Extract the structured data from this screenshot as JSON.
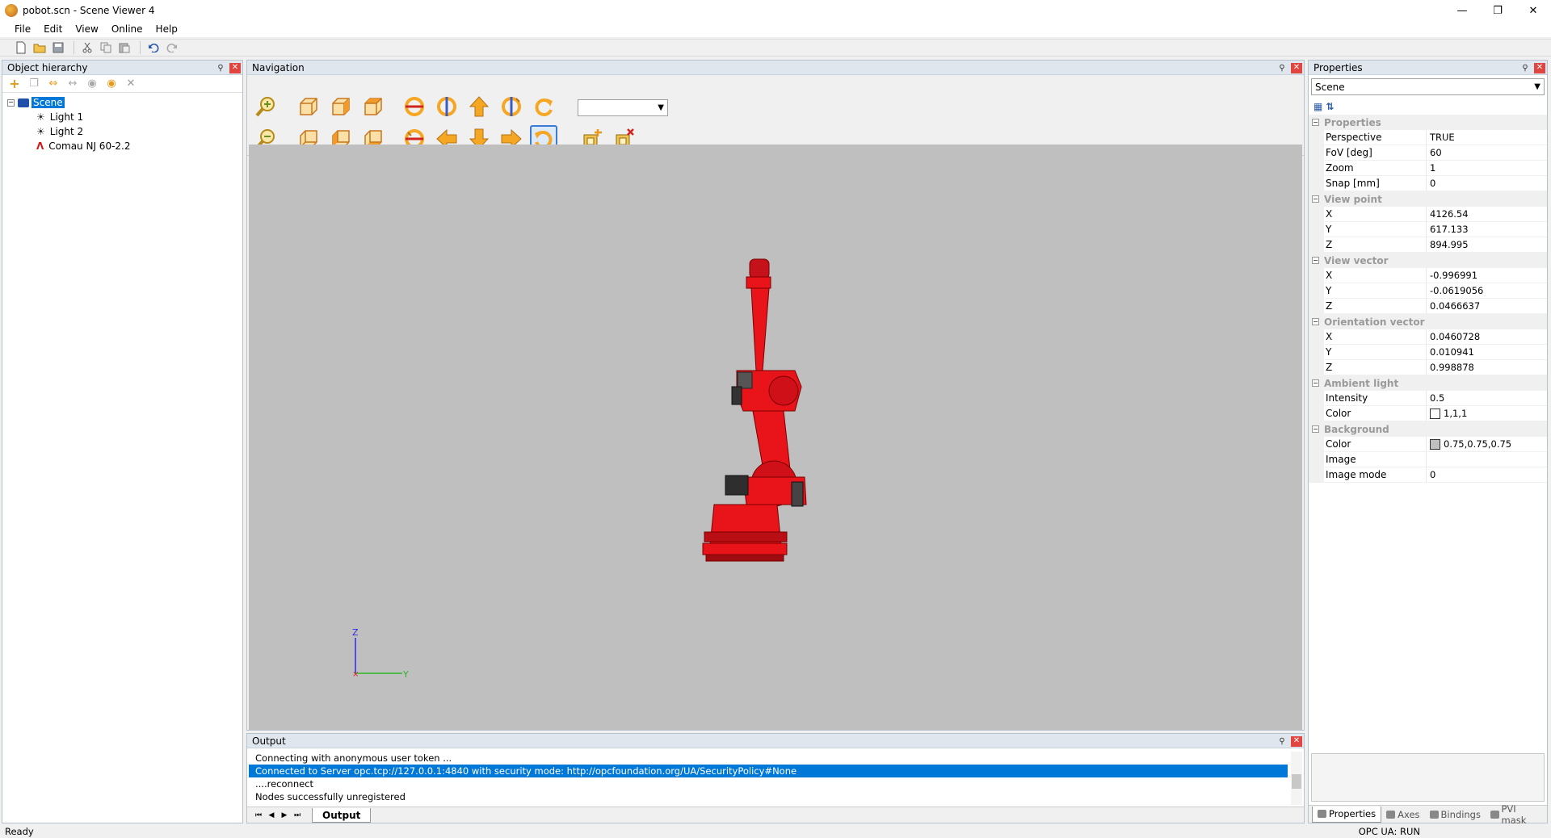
{
  "window": {
    "title": "pobot.scn - Scene Viewer 4"
  },
  "menu": [
    "File",
    "Edit",
    "View",
    "Online",
    "Help"
  ],
  "panels": {
    "hierarchy_title": "Object hierarchy",
    "navigation_title": "Navigation",
    "properties_title": "Properties",
    "output_title": "Output"
  },
  "tree": {
    "scene": "Scene",
    "children": [
      "Light 1",
      "Light 2",
      "Comau NJ 60-2.2"
    ]
  },
  "viewport": {
    "background_color": "#bfbfbf",
    "robot_color": "#e8141a",
    "axis_labels": {
      "z": "Z",
      "y": "Y",
      "x": "X"
    }
  },
  "output": {
    "lines": [
      "Connecting with anonymous user token ...",
      "Connected to Server opc.tcp://127.0.0.1:4840 with security mode: http://opcfoundation.org/UA/SecurityPolicy#None",
      "....reconnect",
      "Nodes successfully unregistered"
    ],
    "selected_index": 1,
    "tab": "Output"
  },
  "properties": {
    "object": "Scene",
    "groups": [
      {
        "name": "Properties",
        "rows": [
          {
            "name": "Perspective",
            "value": "TRUE"
          },
          {
            "name": "FoV [deg]",
            "value": "60"
          },
          {
            "name": "Zoom",
            "value": "1"
          },
          {
            "name": "Snap [mm]",
            "value": "0"
          }
        ]
      },
      {
        "name": "View point",
        "rows": [
          {
            "name": "X",
            "value": "4126.54"
          },
          {
            "name": "Y",
            "value": "617.133"
          },
          {
            "name": "Z",
            "value": "894.995"
          }
        ]
      },
      {
        "name": "View vector",
        "rows": [
          {
            "name": "X",
            "value": "-0.996991"
          },
          {
            "name": "Y",
            "value": "-0.0619056"
          },
          {
            "name": "Z",
            "value": "0.0466637"
          }
        ]
      },
      {
        "name": "Orientation vector",
        "rows": [
          {
            "name": "X",
            "value": "0.0460728"
          },
          {
            "name": "Y",
            "value": "0.010941"
          },
          {
            "name": "Z",
            "value": "0.998878"
          }
        ]
      },
      {
        "name": "Ambient light",
        "rows": [
          {
            "name": "Intensity",
            "value": "0.5"
          },
          {
            "name": "Color",
            "value": "1,1,1",
            "swatch": "#ffffff"
          }
        ]
      },
      {
        "name": "Background",
        "rows": [
          {
            "name": "Color",
            "value": "0.75,0.75,0.75",
            "swatch": "#bfbfbf"
          },
          {
            "name": "Image",
            "value": ""
          },
          {
            "name": "Image mode",
            "value": "0"
          }
        ]
      }
    ],
    "tabs": [
      "Properties",
      "Axes",
      "Bindings",
      "PVI mask"
    ],
    "active_tab": "Properties"
  },
  "status": {
    "left": "Ready",
    "right": "OPC UA: RUN"
  }
}
